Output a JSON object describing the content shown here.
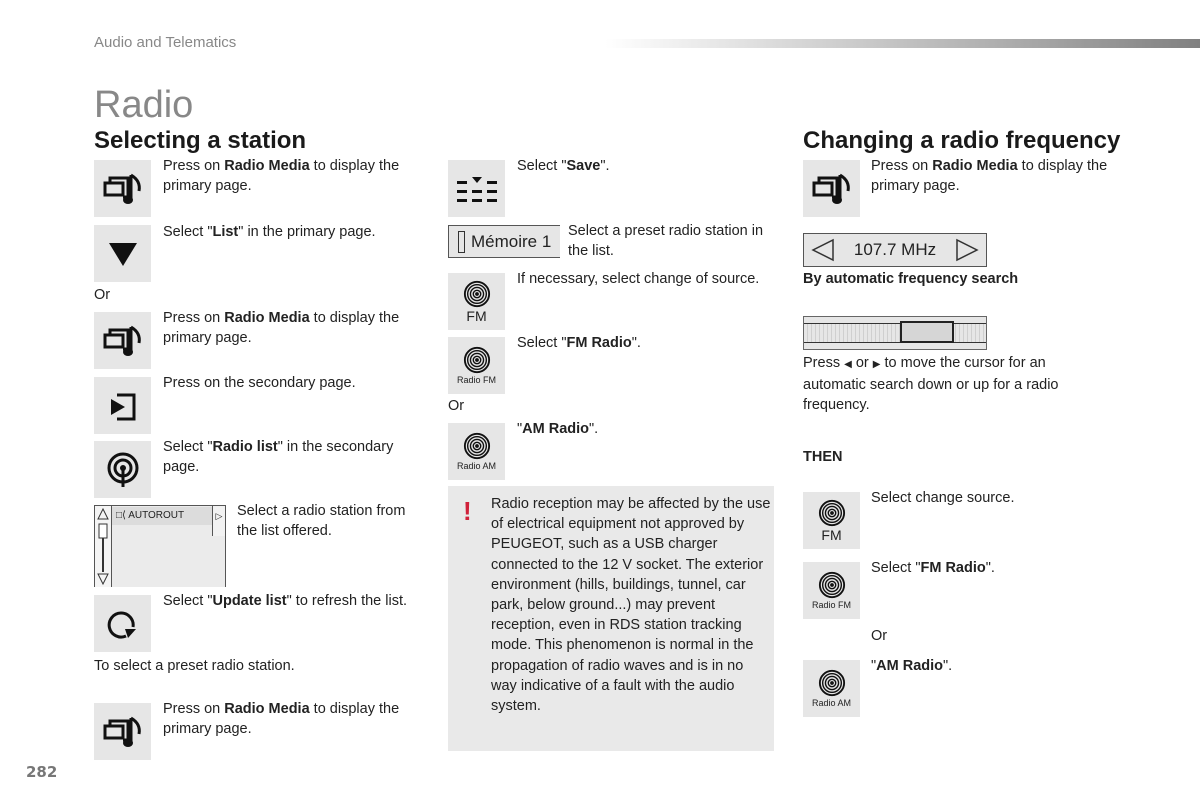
{
  "header": {
    "section_label": "Audio and Telematics",
    "page_title": "Radio",
    "page_number": "282"
  },
  "selecting_station": {
    "title": "Selecting a station",
    "steps": [
      {
        "icon": "radio-media-icon",
        "pre": "Press on ",
        "bold": "Radio Media",
        "post": " to display the primary page."
      },
      {
        "icon": "triangle-down-icon",
        "pre": "Select \"",
        "bold": "List",
        "post": "\" in the primary page."
      },
      {
        "or": "Or"
      },
      {
        "icon": "radio-media-icon",
        "pre": "Press on ",
        "bold": "Radio Media",
        "post": " to display the primary page."
      },
      {
        "icon": "secondary-page-icon",
        "text": "Press on the secondary page."
      },
      {
        "icon": "radio-list-icon",
        "pre": "Select \"",
        "bold": "Radio list",
        "post": "\" in the secondary page."
      },
      {
        "widget": "station-list",
        "station": "AUTOROUT",
        "text": "Select a radio station from the list offered."
      },
      {
        "icon": "refresh-icon",
        "pre": "Select \"",
        "bold": "Update list",
        "post": "\" to refresh the list."
      },
      {
        "text": "To select a preset radio station."
      },
      {
        "icon": "radio-media-icon",
        "pre": "Press on ",
        "bold": "Radio Media",
        "post": " to display the primary page."
      }
    ]
  },
  "middle_column": {
    "steps": [
      {
        "icon": "save-icon",
        "pre": "Select \"",
        "bold": "Save",
        "post": "\"."
      },
      {
        "widget": "preset-button",
        "preset_label": "Mémoire 1",
        "text": "Select a preset radio station in the list."
      },
      {
        "icon": "source-fm-icon",
        "caption": "FM",
        "text": "If necessary, select change of source."
      },
      {
        "icon": "radio-fm-icon",
        "caption": "Radio FM",
        "pre": "Select \"",
        "bold": "FM Radio",
        "post": "\"."
      },
      {
        "or": "Or"
      },
      {
        "icon": "radio-am-icon",
        "caption": "Radio AM",
        "pre": "\"",
        "bold": "AM Radio",
        "post": "\"."
      }
    ],
    "warning": {
      "icon": "!",
      "text": "Radio reception may be affected by the use of electrical equipment not approved by PEUGEOT, such as a USB charger connected to the 12 V socket. The exterior environment (hills, buildings, tunnel, car park, below ground...) may prevent reception, even in RDS station tracking mode. This phenomenon is normal in the propagation of radio waves and is in no way indicative of a fault with the audio system.",
      "accent_color": "#d0213a"
    }
  },
  "changing_frequency": {
    "title": "Changing a radio frequency",
    "step1": {
      "pre": "Press on ",
      "bold": "Radio Media",
      "post": " to display the primary page."
    },
    "frequency_display": "107.7 MHz",
    "auto_search_heading": "By automatic frequency search",
    "search_text_1": "Press",
    "search_text_2": "or",
    "search_text_3": "to move the cursor for an automatic search down or up for a radio frequency.",
    "then_label": "THEN",
    "steps": [
      {
        "icon": "source-fm-icon",
        "caption": "FM",
        "text": "Select change source."
      },
      {
        "icon": "radio-fm-icon",
        "caption": "Radio FM",
        "pre": "Select \"",
        "bold": "FM Radio",
        "post": "\"."
      },
      {
        "or": "Or"
      },
      {
        "icon": "radio-am-icon",
        "caption": "Radio AM",
        "pre": "\"",
        "bold": "AM Radio",
        "post": "\"."
      }
    ]
  }
}
